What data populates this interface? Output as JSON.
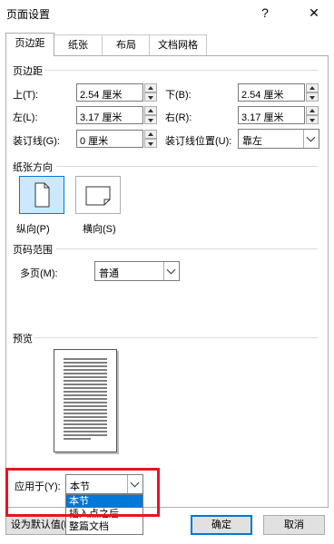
{
  "window": {
    "title": "页面设置",
    "help_label": "?",
    "close_label": "✕"
  },
  "tabs": [
    {
      "label": "页边距",
      "active": true
    },
    {
      "label": "纸张",
      "active": false
    },
    {
      "label": "布局",
      "active": false
    },
    {
      "label": "文档网格",
      "active": false
    }
  ],
  "margins": {
    "group_label": "页边距",
    "top": {
      "label": "上(T):",
      "value": "2.54 厘米"
    },
    "bottom": {
      "label": "下(B):",
      "value": "2.54 厘米"
    },
    "left": {
      "label": "左(L):",
      "value": "3.17 厘米"
    },
    "right": {
      "label": "右(R):",
      "value": "3.17 厘米"
    },
    "gutter": {
      "label": "装订线(G):",
      "value": "0 厘米"
    },
    "gutter_position": {
      "label": "装订线位置(U):",
      "value": "靠左"
    }
  },
  "orientation": {
    "group_label": "纸张方向",
    "portrait_label": "纵向(P)",
    "landscape_label": "横向(S)",
    "selected": "portrait"
  },
  "pages": {
    "group_label": "页码范围",
    "multiple_label": "多页(M):",
    "multiple_value": "普通"
  },
  "preview": {
    "group_label": "预览",
    "apply_label": "应用于(Y):",
    "apply_value": "本节",
    "dropdown_options": [
      "本节",
      "插入点之后",
      "整篇文档"
    ],
    "dropdown_selected": 0
  },
  "buttons": {
    "set_default": "设为默认值(D)",
    "ok": "确定",
    "cancel": "取消"
  },
  "colors": {
    "highlight_box": "#e8141e",
    "selection": "#0078d7"
  }
}
